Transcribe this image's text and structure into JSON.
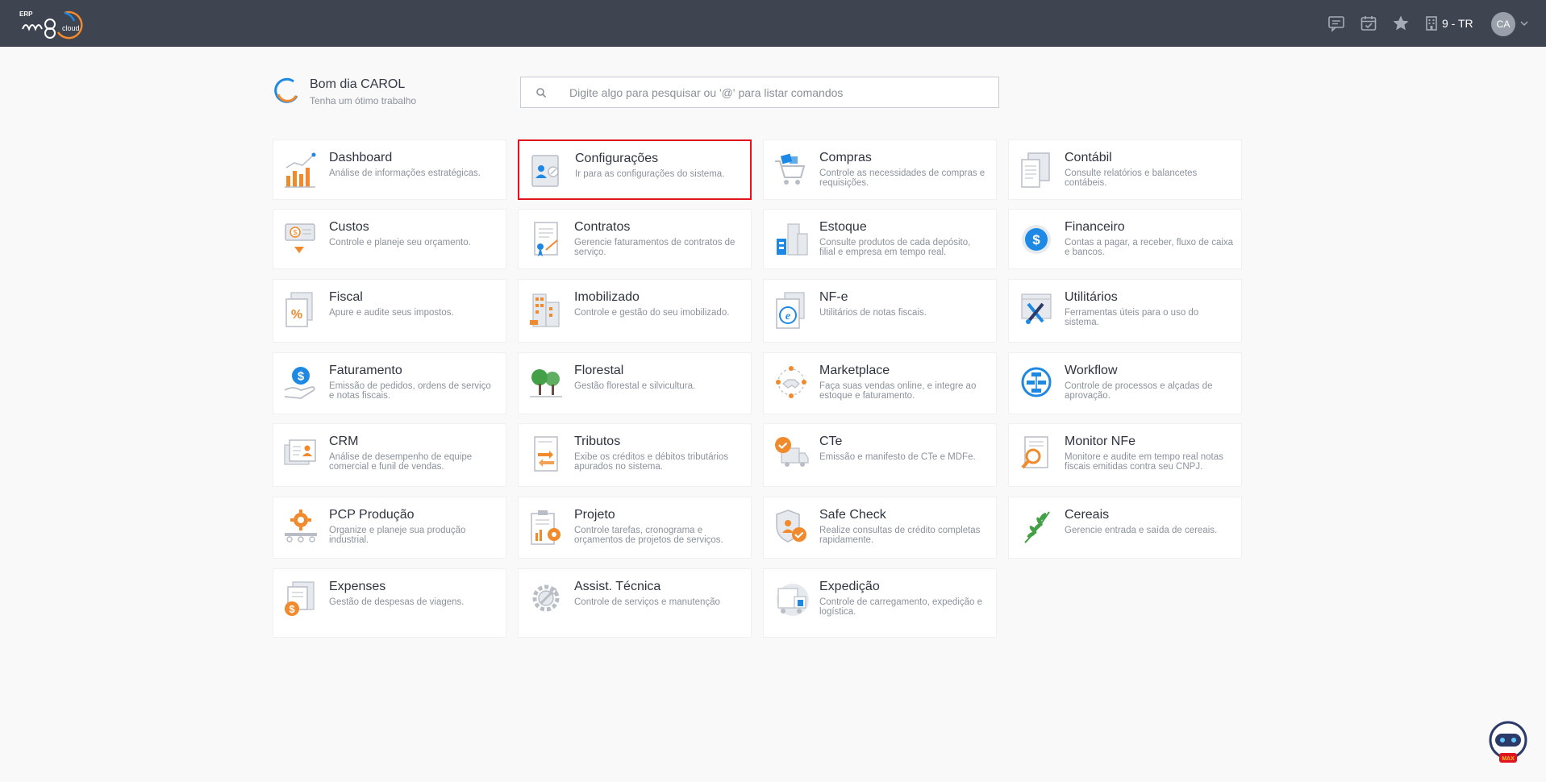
{
  "topbar": {
    "logo_text": "ERP m8 cloud",
    "company_label": "9 - TR",
    "avatar_initials": "CA",
    "icons": [
      "chat-icon",
      "calendar-check-icon",
      "star-icon",
      "building-icon"
    ]
  },
  "greeting": {
    "title": "Bom dia CAROL",
    "subtitle": "Tenha um ótimo trabalho"
  },
  "search": {
    "placeholder": "Digite algo para pesquisar ou '@' para listar comandos",
    "value": ""
  },
  "modules": [
    {
      "title": "Dashboard",
      "description": "Análise de informações estratégicas.",
      "icon": "bar-chart-icon"
    },
    {
      "title": "Configurações",
      "description": "Ir para as configurações do sistema.",
      "icon": "settings-profile-icon",
      "selected": true
    },
    {
      "title": "Compras",
      "description": "Controle as necessidades de compras e requisições.",
      "icon": "shopping-cart-icon"
    },
    {
      "title": "Contábil",
      "description": "Consulte relatórios e balancetes contábeis.",
      "icon": "ledger-icon"
    },
    {
      "title": "Custos",
      "description": "Controle e planeje seu orçamento.",
      "icon": "money-cost-icon"
    },
    {
      "title": "Contratos",
      "description": "Gerencie faturamentos de contratos de serviço.",
      "icon": "contract-icon"
    },
    {
      "title": "Estoque",
      "description": "Consulte produtos de cada depósito, filial e empresa em tempo real.",
      "icon": "warehouse-icon"
    },
    {
      "title": "Financeiro",
      "description": "Contas a pagar, a receber, fluxo de caixa e bancos.",
      "icon": "dollar-circle-icon"
    },
    {
      "title": "Fiscal",
      "description": "Apure e audite seus impostos.",
      "icon": "percent-document-icon"
    },
    {
      "title": "Imobilizado",
      "description": "Controle e gestão do seu imobilizado.",
      "icon": "buildings-icon"
    },
    {
      "title": "NF-e",
      "description": "Utilitários de notas fiscais.",
      "icon": "nfe-document-icon"
    },
    {
      "title": "Utilitários",
      "description": "Ferramentas úteis para o uso do sistema.",
      "icon": "tools-icon"
    },
    {
      "title": "Faturamento",
      "description": "Emissão de pedidos, ordens de serviço e notas fiscais.",
      "icon": "dollar-hand-icon"
    },
    {
      "title": "Florestal",
      "description": "Gestão florestal e silvicultura.",
      "icon": "trees-icon"
    },
    {
      "title": "Marketplace",
      "description": "Faça suas vendas online, e integre ao estoque e faturamento.",
      "icon": "handshake-icon"
    },
    {
      "title": "Workflow",
      "description": "Controle de processos e alçadas de aprovação.",
      "icon": "workflow-icon"
    },
    {
      "title": "CRM",
      "description": "Análise de desempenho de equipe comercial e funil de vendas.",
      "icon": "contact-cards-icon"
    },
    {
      "title": "Tributos",
      "description": "Exibe os créditos e débitos tributários apurados no sistema.",
      "icon": "tax-arrows-icon"
    },
    {
      "title": "CTe",
      "description": "Emissão e manifesto de CTe e MDFe.",
      "icon": "truck-check-icon"
    },
    {
      "title": "Monitor NFe",
      "description": "Monitore e audite em tempo real notas fiscais emitidas contra seu CNPJ.",
      "icon": "magnifier-document-icon"
    },
    {
      "title": "PCP Produção",
      "description": "Organize e planeje sua produção industrial.",
      "icon": "production-gear-icon"
    },
    {
      "title": "Projeto",
      "description": "Controle tarefas, cronograma e orçamentos de projetos de serviços.",
      "icon": "project-clipboard-icon"
    },
    {
      "title": "Safe Check",
      "description": "Realize consultas de crédito completas rapidamente.",
      "icon": "shield-check-icon"
    },
    {
      "title": "Cereais",
      "description": "Gerencie entrada e saída de cereais.",
      "icon": "wheat-icon"
    },
    {
      "title": "Expenses",
      "description": "Gestão de despesas de viagens.",
      "icon": "expenses-icon"
    },
    {
      "title": "Assist. Técnica",
      "description": "Controle de serviços e manutenção",
      "icon": "wrench-gear-icon"
    },
    {
      "title": "Expedição",
      "description": "Controle de carregamento, expedição e logística.",
      "icon": "shipping-icon"
    }
  ],
  "assistant": {
    "label": "MAX"
  },
  "colors": {
    "topbar": "#3f4451",
    "accent_orange": "#f08a2c",
    "accent_blue": "#1e88e5",
    "selected_border": "#e0141e"
  }
}
